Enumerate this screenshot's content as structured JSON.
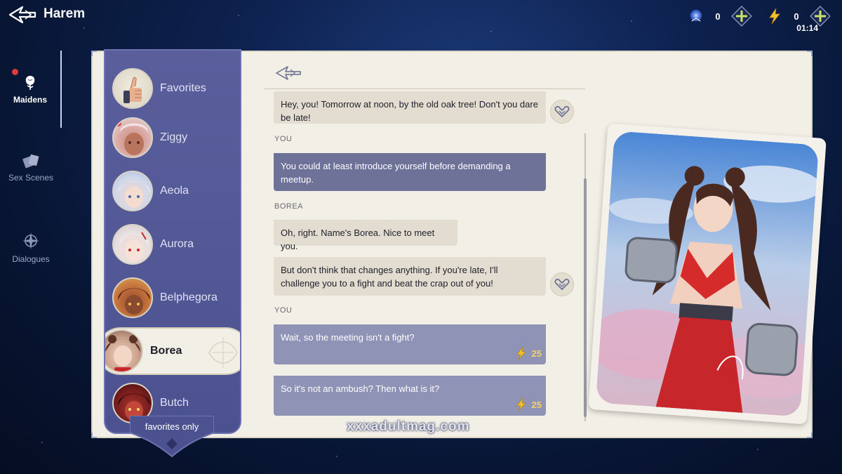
{
  "app": {
    "title": "Harem"
  },
  "resources": {
    "roses": {
      "icon": "blue-rose-icon",
      "value": "0"
    },
    "energy": {
      "icon": "lightning-icon",
      "value": "0",
      "timer": "01:14"
    }
  },
  "nav": {
    "items": [
      {
        "label": "Maidens",
        "icon": "rose-icon",
        "active": true,
        "notification": true
      },
      {
        "label": "Sex Scenes",
        "icon": "cards-icon",
        "active": false
      },
      {
        "label": "Dialogues",
        "icon": "compass-icon",
        "active": false
      }
    ]
  },
  "maidens": {
    "items": [
      {
        "name": "Favorites",
        "icon": "thumbs-up-icon"
      },
      {
        "name": "Ziggy",
        "notification": true
      },
      {
        "name": "Aeola"
      },
      {
        "name": "Aurora"
      },
      {
        "name": "Belphegora"
      },
      {
        "name": "Borea",
        "selected": true
      },
      {
        "name": "Butch"
      }
    ],
    "footer_label": "favorites only"
  },
  "chat": {
    "messages": [
      {
        "speaker": "",
        "text": "Hey, you! Tomorrow at noon, by the old oak tree! Don't you dare be late!"
      },
      {
        "speaker": "YOU",
        "text": "You could at least introduce yourself before demanding a meetup."
      },
      {
        "speaker": "BOREA",
        "text": "Oh, right. Name's Borea. Nice to meet you."
      },
      {
        "speaker": "",
        "text": "But don't think that changes anything. If you're late, I'll challenge you to a fight and beat the crap out of you!"
      },
      {
        "speaker": "YOU",
        "text": "Wait, so the meeting isn't a fight?",
        "cost": "25"
      },
      {
        "speaker": "",
        "text": "So it's not an ambush? Then what is it?",
        "cost": "25"
      }
    ]
  },
  "watermark": "xxxadultmag.com",
  "colors": {
    "accent": "#6e7299",
    "panel": "#f2efe6",
    "list": "#4c5190",
    "energy": "#f2d36a"
  }
}
